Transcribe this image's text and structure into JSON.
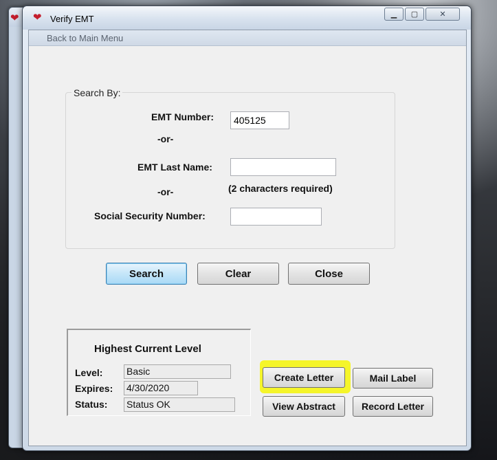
{
  "window": {
    "title": "Verify EMT",
    "app_icon": "heart-icon",
    "minimize_glyph": "▁",
    "maximize_glyph": "▢",
    "close_glyph": "✕"
  },
  "menu": {
    "back_label": "Back to Main Menu"
  },
  "search": {
    "group_title": "Search By:",
    "emt_number_label": "EMT Number:",
    "emt_number_value": "405125",
    "or_1": "-or-",
    "last_name_label": "EMT Last Name:",
    "last_name_value": "",
    "last_name_hint": "(2 characters required)",
    "or_2": "-or-",
    "ssn_label": "Social Security Number:",
    "ssn_value": ""
  },
  "buttons": {
    "search": "Search",
    "clear": "Clear",
    "close": "Close",
    "create_letter": "Create Letter",
    "mail_label": "Mail Label",
    "view_abstract": "View Abstract",
    "record_letter": "Record Letter"
  },
  "level": {
    "title": "Highest Current Level",
    "level_label": "Level:",
    "level_value": "Basic",
    "expires_label": "Expires:",
    "expires_value": "4/30/2020",
    "status_label": "Status:",
    "status_value": "Status OK"
  },
  "colors": {
    "highlight": "#f5f52a",
    "default_button": "#a9d9f6",
    "title_icon": "#c41f2e"
  }
}
